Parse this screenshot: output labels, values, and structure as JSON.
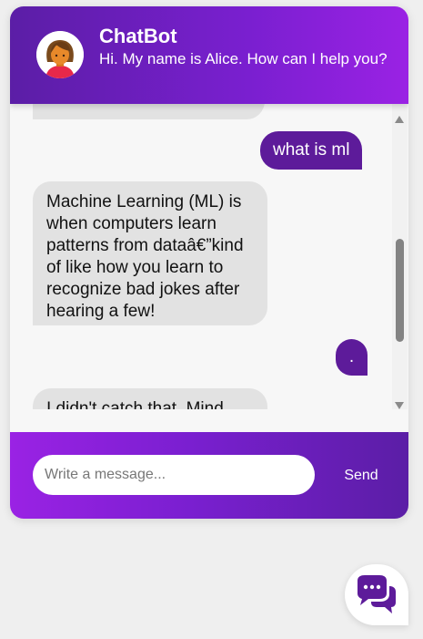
{
  "header": {
    "title": "ChatBot",
    "subtitle": "Hi. My name is Alice. How can I help you?",
    "avatar_icon": "female-avatar-icon"
  },
  "messages": [
    {
      "sender": "bot",
      "text": ""
    },
    {
      "sender": "user",
      "text": "what is ml"
    },
    {
      "sender": "bot",
      "text": "Machine Learning (ML) is when computers learn patterns from dataâ€”kind of like how you learn to recognize bad jokes after hearing a few!"
    },
    {
      "sender": "user",
      "text": "."
    },
    {
      "sender": "bot",
      "text": "I didn't catch that. Mind"
    }
  ],
  "composer": {
    "placeholder": "Write a message...",
    "value": "",
    "send_label": "Send"
  },
  "launcher": {
    "icon": "chat-bubbles-icon"
  },
  "colors": {
    "accent_dark": "#5b1ea6",
    "accent_light": "#9a22e4",
    "user_bubble": "#5d1b9a",
    "bot_bubble": "#e2e2e2"
  }
}
